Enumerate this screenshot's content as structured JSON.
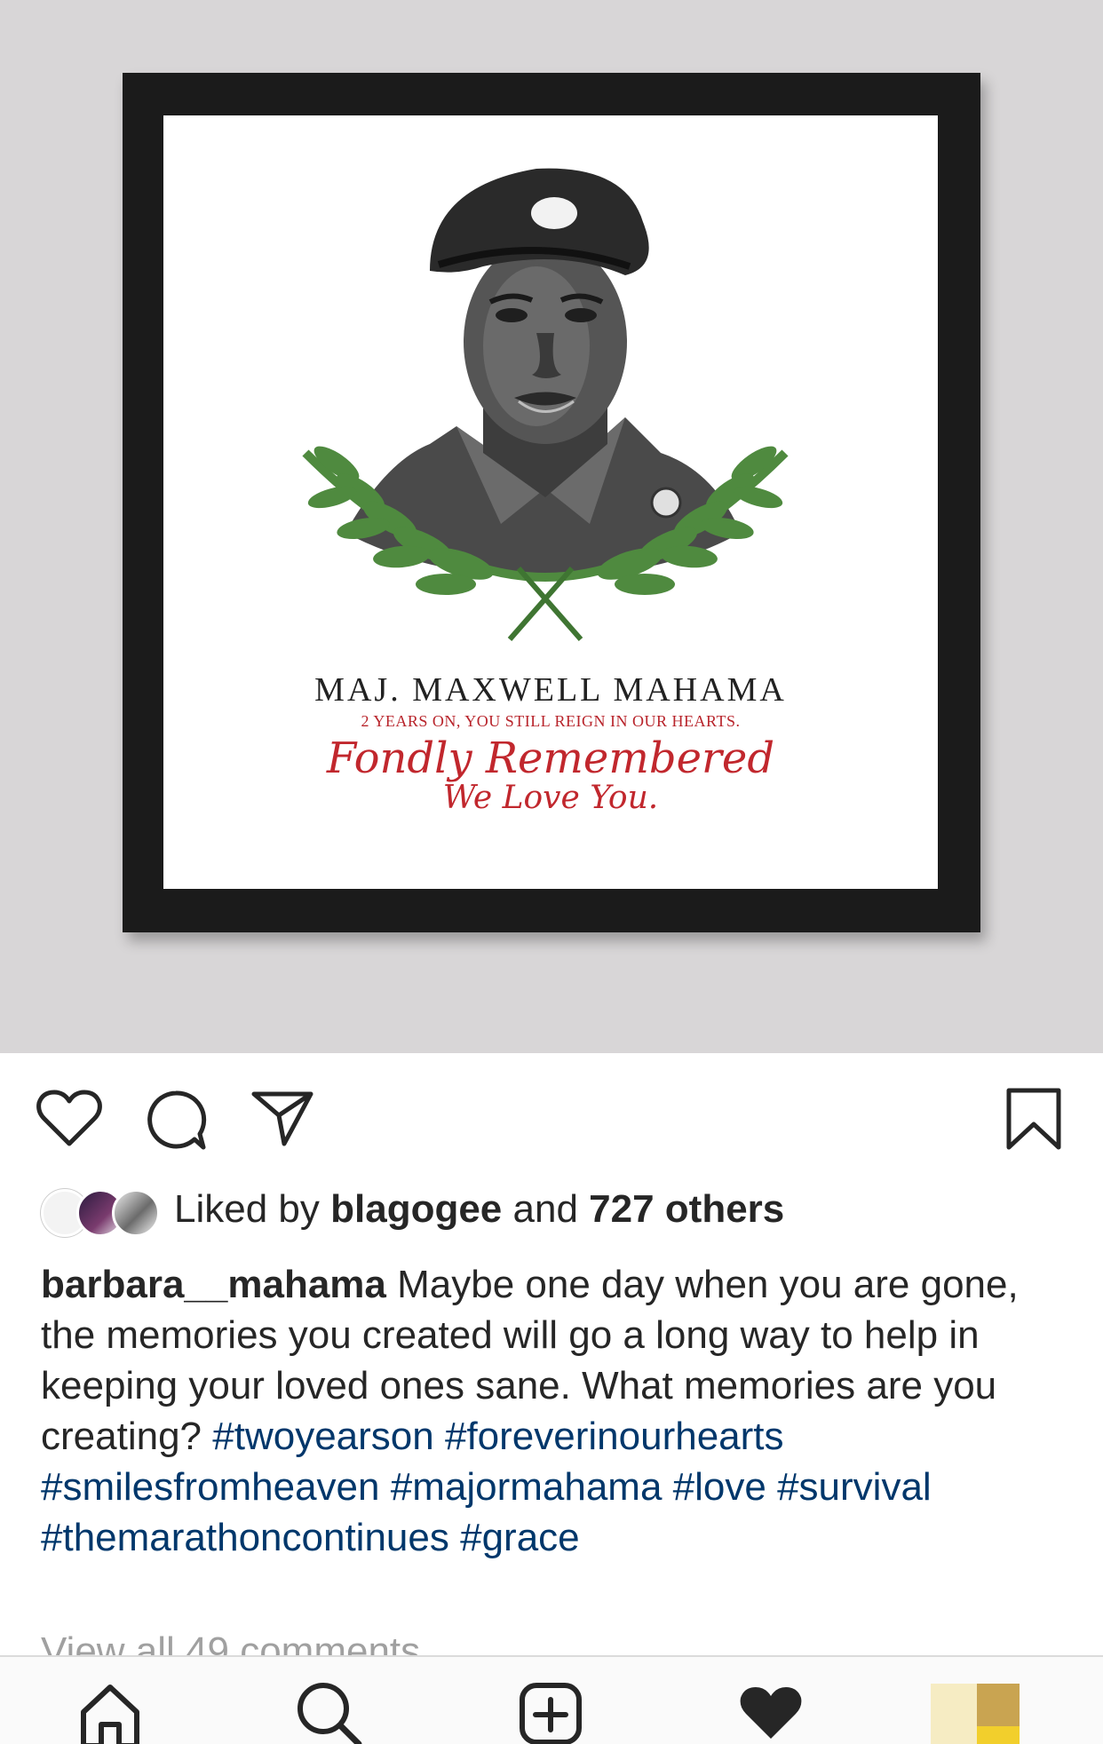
{
  "post": {
    "memorial": {
      "title": "MAJ. MAXWELL MAHAMA",
      "subtitle": "2 YEARS ON, YOU STILL REIGN IN OUR HEARTS.",
      "script_line1": "Fondly Remembered",
      "script_line2": "We Love You."
    },
    "actions": {
      "like_icon": "heart-outline-icon",
      "comment_icon": "comment-bubble-icon",
      "share_icon": "paper-plane-icon",
      "save_icon": "bookmark-icon"
    },
    "likes": {
      "prefix": "Liked by",
      "user": "blagogee",
      "connector": "and",
      "others": "727 others"
    },
    "caption": {
      "username": "barbara__mahama",
      "text": "Maybe one day when you are gone, the memories you created will go a long way to help in keeping your loved ones sane. What memories are you creating?",
      "hashtags": [
        "#twoyearson",
        "#foreverinourhearts",
        "#smilesfromheaven",
        "#majormahama",
        "#love",
        "#survival",
        "#themarathoncontinues",
        "#grace"
      ]
    },
    "view_comments": "View all 49 comments"
  },
  "tabbar": {
    "items": [
      "home-icon",
      "search-icon",
      "new-post-icon",
      "activity-heart-icon",
      "profile-avatar"
    ]
  },
  "colors": {
    "hashtag": "#00376b",
    "text": "#262626",
    "memorial_red": "#c1272d",
    "leaf_green": "#4f8a3f",
    "frame": "#1b1b1b",
    "backdrop": "#d8d6d7"
  }
}
